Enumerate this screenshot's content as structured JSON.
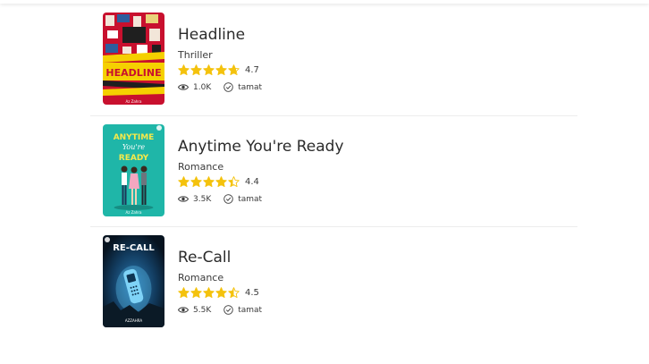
{
  "books": [
    {
      "title": "Headline",
      "genre": "Thriller",
      "rating": 4.7,
      "rating_text": "4.7",
      "views": "1.0K",
      "status": "tamat",
      "cover_title": "HEADLINE",
      "cover_author": "Az Zahra"
    },
    {
      "title": "Anytime You're Ready",
      "genre": "Romance",
      "rating": 4.4,
      "rating_text": "4.4",
      "views": "3.5K",
      "status": "tamat",
      "cover_title_line1": "ANYTIME",
      "cover_title_line2": "You're",
      "cover_title_line3": "READY",
      "cover_author": "Az Zahra"
    },
    {
      "title": "Re-Call",
      "genre": "Romance",
      "rating": 4.5,
      "rating_text": "4.5",
      "views": "5.5K",
      "status": "tamat",
      "cover_title": "RE-CALL",
      "cover_author": "AZZAHRA"
    }
  ],
  "icons": {
    "views": "eye-icon",
    "status": "check-circle-icon",
    "rating": "star-icon"
  },
  "colors": {
    "star": "#f4c20d",
    "star_empty": "#f4c20d",
    "divider": "#ececec",
    "text": "#2b2b2b"
  }
}
